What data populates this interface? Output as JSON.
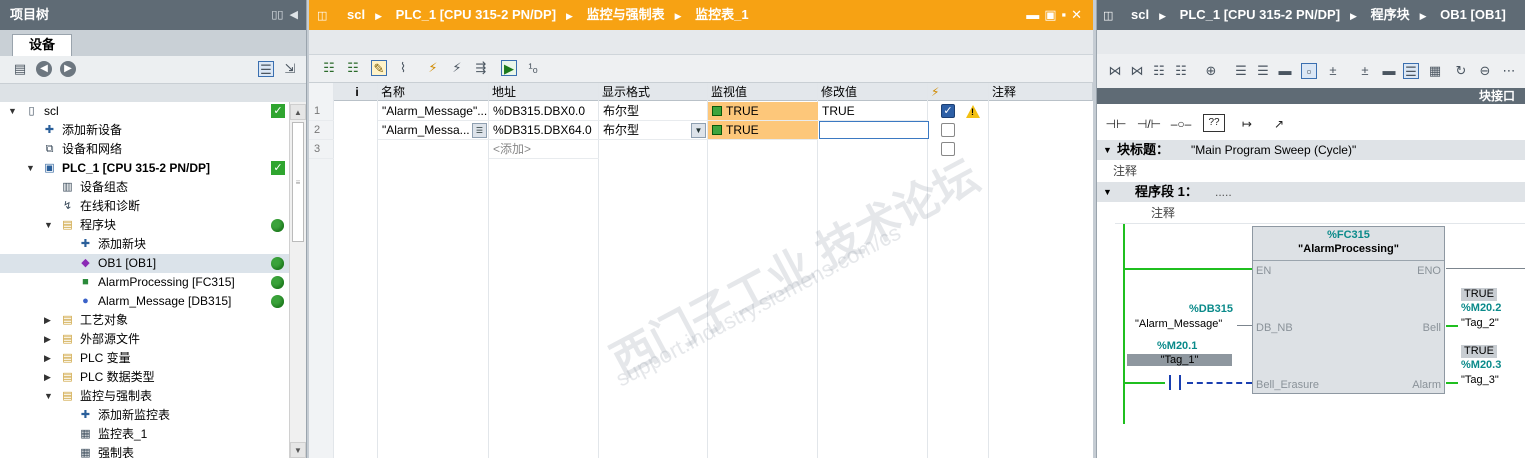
{
  "left": {
    "title": "项目树",
    "tab": "设备",
    "tree": [
      {
        "label": "scl",
        "level": 0,
        "arrow": "▼",
        "icon": "project-icon",
        "status": "check"
      },
      {
        "label": "添加新设备",
        "level": 1,
        "icon": "add-device-icon"
      },
      {
        "label": "设备和网络",
        "level": 1,
        "icon": "network-icon"
      },
      {
        "label": "PLC_1 [CPU 315-2 PN/DP]",
        "level": 1,
        "arrow": "▼",
        "icon": "plc-icon",
        "status": "check",
        "bold": true
      },
      {
        "label": "设备组态",
        "level": 2,
        "icon": "device-config-icon"
      },
      {
        "label": "在线和诊断",
        "level": 2,
        "icon": "diagnostics-icon"
      },
      {
        "label": "程序块",
        "level": 2,
        "arrow": "▼",
        "icon": "folder-icon",
        "status": "green"
      },
      {
        "label": "添加新块",
        "level": 3,
        "icon": "add-block-icon"
      },
      {
        "label": "OB1 [OB1]",
        "level": 3,
        "icon": "ob-icon",
        "status": "green",
        "selected": true
      },
      {
        "label": "AlarmProcessing [FC315]",
        "level": 3,
        "icon": "fc-icon",
        "status": "green"
      },
      {
        "label": "Alarm_Message [DB315]",
        "level": 3,
        "icon": "db-icon",
        "status": "green"
      },
      {
        "label": "工艺对象",
        "level": 2,
        "arrow": "▶",
        "icon": "folder-icon"
      },
      {
        "label": "外部源文件",
        "level": 2,
        "arrow": "▶",
        "icon": "folder-icon"
      },
      {
        "label": "PLC 变量",
        "level": 2,
        "arrow": "▶",
        "icon": "folder-icon"
      },
      {
        "label": "PLC 数据类型",
        "level": 2,
        "arrow": "▶",
        "icon": "folder-icon"
      },
      {
        "label": "监控与强制表",
        "level": 2,
        "arrow": "▼",
        "icon": "folder-icon"
      },
      {
        "label": "添加新监控表",
        "level": 3,
        "icon": "add-table-icon"
      },
      {
        "label": "监控表_1",
        "level": 3,
        "icon": "table-icon"
      },
      {
        "label": "强制表",
        "level": 3,
        "icon": "table-icon"
      }
    ]
  },
  "mid": {
    "breadcrumb": [
      "scl",
      "PLC_1 [CPU 315-2 PN/DP]",
      "监控与强制表",
      "监控表_1"
    ],
    "columns": {
      "i": "i",
      "name": "名称",
      "addr": "地址",
      "fmt": "显示格式",
      "mon": "监视值",
      "mod": "修改值",
      "force": "⚡",
      "cmt": "注释"
    },
    "rows": [
      {
        "n": "1",
        "name": "\"Alarm_Message\"...",
        "addr": "%DB315.DBX0.0",
        "fmt": "布尔型",
        "mon": "TRUE",
        "mod": "TRUE",
        "checked": true,
        "warn": true
      },
      {
        "n": "2",
        "name": "\"Alarm_Messa...",
        "addr": "%DB315.DBX64.0",
        "fmt": "布尔型",
        "mon": "TRUE",
        "mod": "",
        "checked": false,
        "warn": false
      },
      {
        "n": "3",
        "addr": "<添加>"
      }
    ],
    "watermark": "西门子工业 技术论坛",
    "watermark_url": "support.industry.siemens.com/cs"
  },
  "right": {
    "breadcrumb": [
      "scl",
      "PLC_1 [CPU 315-2 PN/DP]",
      "程序块",
      "OB1 [OB1]"
    ],
    "iface": "块接口",
    "block_title_label": "块标题：",
    "block_title_value": "\"Main Program Sweep (Cycle)\"",
    "comment": "注释",
    "network_label": "程序段 1：",
    "network_dots": ".....",
    "network_comment": "注释",
    "ladder_buttons": [
      "⊣⊢",
      "⊣/⊢",
      "–○–",
      "??",
      "↦",
      "↗"
    ],
    "fb": {
      "addr": "%FC315",
      "name": "\"AlarmProcessing\"",
      "pins": {
        "en": "EN",
        "eno": "ENO",
        "db_nb": "DB_NB",
        "bell": "Bell",
        "bell_erasure": "Bell_Erasure",
        "alarm": "Alarm"
      },
      "db_addr": "%DB315",
      "db_name": "\"Alarm_Message\"",
      "tag1_addr": "%M20.1",
      "tag1_name": "\"Tag_1\"",
      "out1_val": "TRUE",
      "out1_addr": "%M20.2",
      "out1_name": "\"Tag_2\"",
      "out2_val": "TRUE",
      "out2_addr": "%M20.3",
      "out2_name": "\"Tag_3\""
    }
  }
}
